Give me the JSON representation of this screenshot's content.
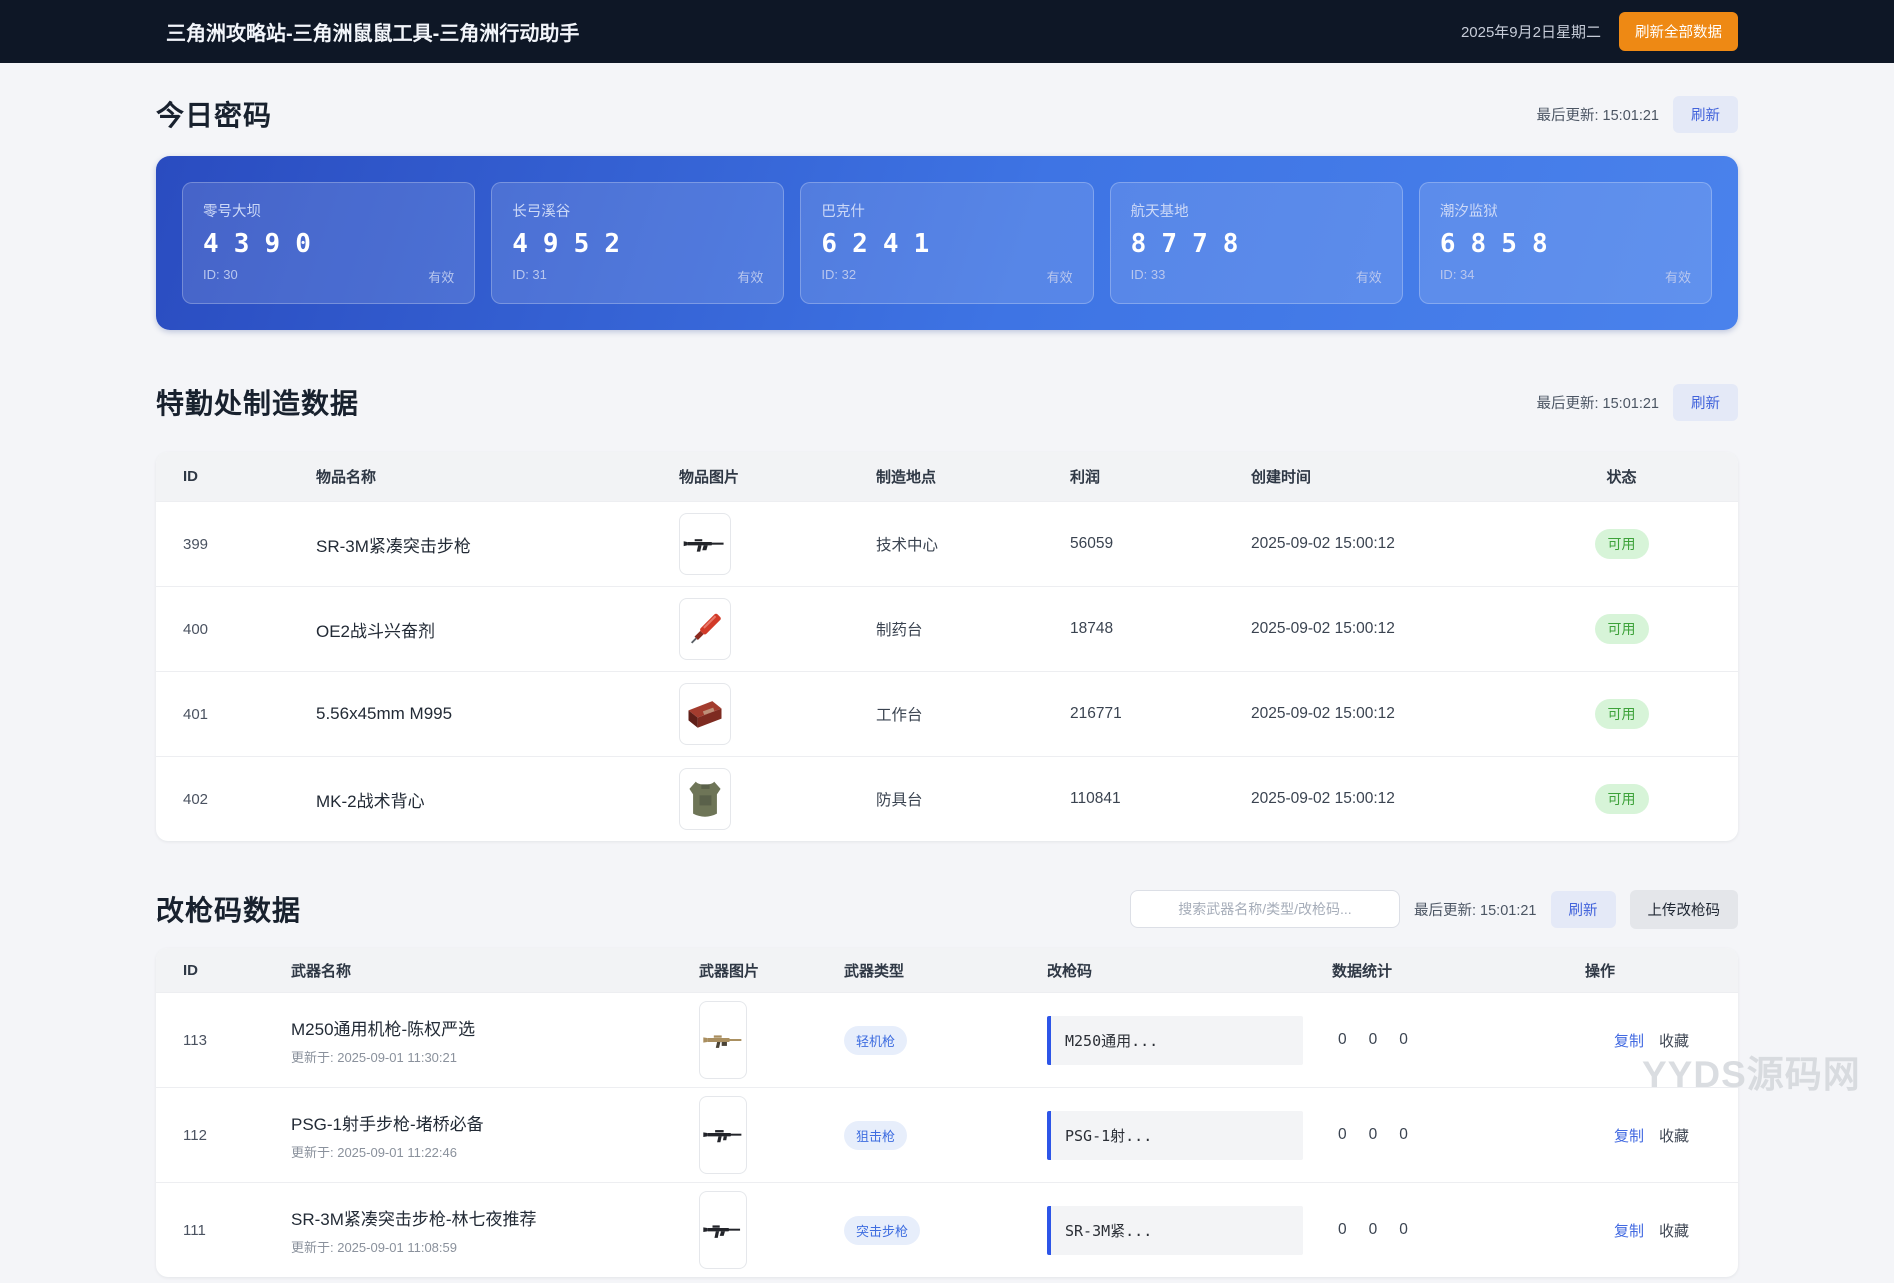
{
  "colors": {
    "accent_orange": "#ee8914",
    "accent_blue": "#3e74e4",
    "status_green": "#3da23a",
    "code_border_blue": "#2d55e8",
    "topbar_bg": "#0e1726"
  },
  "header": {
    "title": "三角洲攻略站-三角洲鼠鼠工具-三角洲行动助手",
    "date": "2025年9月2日星期二",
    "refresh_all_label": "刷新全部数据"
  },
  "passwords": {
    "section_title": "今日密码",
    "last_update_label": "最后更新:",
    "last_update_time": "15:01:21",
    "refresh_label": "刷新",
    "cards": [
      {
        "map": "零号大坝",
        "code": "4390",
        "id": "ID: 30",
        "status": "有效"
      },
      {
        "map": "长弓溪谷",
        "code": "4952",
        "id": "ID: 31",
        "status": "有效"
      },
      {
        "map": "巴克什",
        "code": "6241",
        "id": "ID: 32",
        "status": "有效"
      },
      {
        "map": "航天基地",
        "code": "8778",
        "id": "ID: 33",
        "status": "有效"
      },
      {
        "map": "潮汐监狱",
        "code": "6858",
        "id": "ID: 34",
        "status": "有效"
      }
    ]
  },
  "manufacturing": {
    "section_title": "特勤处制造数据",
    "last_update_label": "最后更新:",
    "last_update_time": "15:01:21",
    "refresh_label": "刷新",
    "columns": [
      "ID",
      "物品名称",
      "物品图片",
      "制造地点",
      "利润",
      "创建时间",
      "状态"
    ],
    "rows": [
      {
        "id": "399",
        "name": "SR-3M紧凑突击步枪",
        "place": "技术中心",
        "profit": "56059",
        "created": "2025-09-02 15:00:12",
        "status": "可用",
        "image": "rifle"
      },
      {
        "id": "400",
        "name": "OE2战斗兴奋剂",
        "place": "制药台",
        "profit": "18748",
        "created": "2025-09-02 15:00:12",
        "status": "可用",
        "image": "stim"
      },
      {
        "id": "401",
        "name": "5.56x45mm M995",
        "place": "工作台",
        "profit": "216771",
        "created": "2025-09-02 15:00:12",
        "status": "可用",
        "image": "ammo"
      },
      {
        "id": "402",
        "name": "MK-2战术背心",
        "place": "防具台",
        "profit": "110841",
        "created": "2025-09-02 15:00:12",
        "status": "可用",
        "image": "vest"
      }
    ]
  },
  "gun_codes": {
    "section_title": "改枪码数据",
    "search_placeholder": "搜索武器名称/类型/改枪码...",
    "last_update_label": "最后更新:",
    "last_update_time": "15:01:21",
    "refresh_label": "刷新",
    "upload_label": "上传改枪码",
    "columns": [
      "ID",
      "武器名称",
      "武器图片",
      "武器类型",
      "改枪码",
      "数据统计",
      "操作"
    ],
    "rows": [
      {
        "id": "113",
        "name": "M250通用机枪-陈权严选",
        "updated": "更新于: 2025-09-01 11:30:21",
        "type": "轻机枪",
        "code": "M250通用...",
        "stats": [
          "0",
          "0",
          "0"
        ],
        "copy": "复制",
        "favorite": "收藏"
      },
      {
        "id": "112",
        "name": "PSG-1射手步枪-堵桥必备",
        "updated": "更新于: 2025-09-01 11:22:46",
        "type": "狙击枪",
        "code": "PSG-1射...",
        "stats": [
          "0",
          "0",
          "0"
        ],
        "copy": "复制",
        "favorite": "收藏"
      },
      {
        "id": "111",
        "name": "SR-3M紧凑突击步枪-林七夜推荐",
        "updated": "更新于: 2025-09-01 11:08:59",
        "type": "突击步枪",
        "code": "SR-3M紧...",
        "stats": [
          "0",
          "0",
          "0"
        ],
        "copy": "复制",
        "favorite": "收藏"
      }
    ]
  },
  "watermark": "YYDS源码网"
}
